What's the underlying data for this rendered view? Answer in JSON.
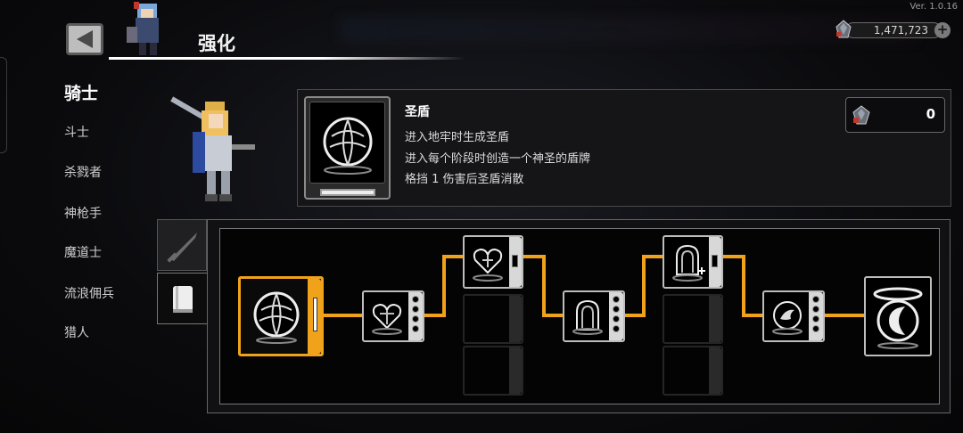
{
  "version": "Ver. 1.0.16",
  "header": {
    "title": "强化"
  },
  "currency": {
    "amount": "1,471,723"
  },
  "classes": [
    {
      "label": "骑士",
      "active": true
    },
    {
      "label": "斗士",
      "active": false
    },
    {
      "label": "杀戮者",
      "active": false
    },
    {
      "label": "神枪手",
      "active": false
    },
    {
      "label": "魔道士",
      "active": false
    },
    {
      "label": "流浪佣兵",
      "active": false
    },
    {
      "label": "猎人",
      "active": false
    }
  ],
  "skill": {
    "name": "圣盾",
    "lines": [
      "进入地牢时生成圣盾",
      "进入每个阶段时创造一个神圣的盾牌",
      "格挡 1 伤害后圣盾消散"
    ],
    "cost": "0"
  },
  "tabs": [
    {
      "icon": "sword-icon",
      "active": false
    },
    {
      "icon": "book-icon",
      "active": true
    }
  ],
  "colors": {
    "accent": "#f0a21a",
    "panel": "#151517"
  }
}
